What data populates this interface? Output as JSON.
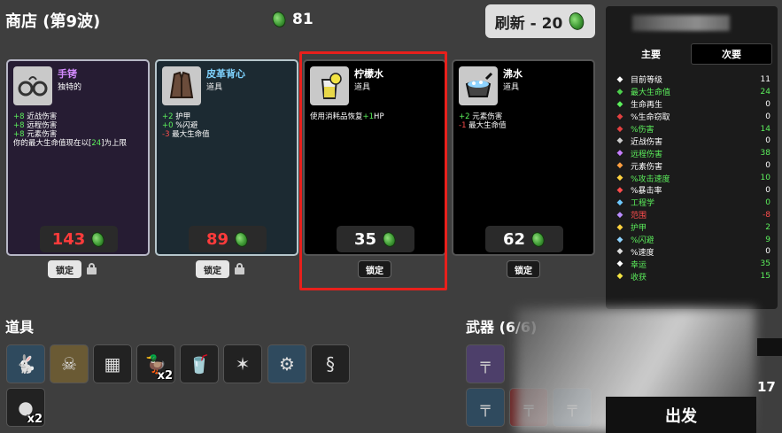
{
  "header": {
    "title": "商店 (第9波)",
    "materials": "81",
    "refresh_label": "刷新 - 20"
  },
  "shop": [
    {
      "name": "手铐",
      "type": "独特的",
      "stats": [
        {
          "prefix": "+8",
          "text": " 近战伤害",
          "tone": "pos"
        },
        {
          "prefix": "+8",
          "text": " 远程伤害",
          "tone": "pos"
        },
        {
          "prefix": "+8",
          "text": " 元素伤害",
          "tone": "pos"
        }
      ],
      "note_a": "你的最大生命值现在以[",
      "note_hl": "24",
      "note_b": "]为上限",
      "price": "143",
      "price_red": true,
      "lock_label": "锁定",
      "icon": "handcuffs-icon"
    },
    {
      "name": "皮革背心",
      "type": "道具",
      "stats": [
        {
          "prefix": "+2",
          "text": " 护甲",
          "tone": "pos"
        },
        {
          "prefix": "+0",
          "text": " %闪避",
          "tone": "pos"
        },
        {
          "prefix": "-3",
          "text": " 最大生命值",
          "tone": "neg"
        }
      ],
      "price": "89",
      "price_red": true,
      "lock_label": "锁定",
      "icon": "leather-vest-icon"
    },
    {
      "name": "柠檬水",
      "type": "道具",
      "desc_a": "使用消耗品恢复",
      "desc_hl": "+1",
      "desc_b": "HP",
      "price": "35",
      "price_red": false,
      "lock_label": "锁定",
      "icon": "lemonade-icon"
    },
    {
      "name": "沸水",
      "type": "道具",
      "stats": [
        {
          "prefix": "+2",
          "text": " 元素伤害",
          "tone": "pos"
        },
        {
          "prefix": "-1",
          "text": " 最大生命值",
          "tone": "neg"
        }
      ],
      "price": "62",
      "price_red": false,
      "lock_label": "锁定",
      "icon": "boiling-water-icon"
    }
  ],
  "stats_panel": {
    "tab_primary": "主要",
    "tab_secondary": "次要",
    "rows": [
      {
        "label": "目前等级",
        "value": "11",
        "color": "white",
        "icon": "level-icon"
      },
      {
        "label": "最大生命值",
        "value": "24",
        "color": "green",
        "icon": "heart-icon"
      },
      {
        "label": "生命再生",
        "value": "0",
        "color": "white",
        "icon": "regen-icon"
      },
      {
        "label": "%生命窃取",
        "value": "0",
        "color": "white",
        "icon": "lifesteal-icon"
      },
      {
        "label": "%伤害",
        "value": "14",
        "color": "green",
        "icon": "damage-icon"
      },
      {
        "label": "近战伤害",
        "value": "0",
        "color": "white",
        "icon": "melee-icon"
      },
      {
        "label": "远程伤害",
        "value": "38",
        "color": "green",
        "icon": "ranged-icon"
      },
      {
        "label": "元素伤害",
        "value": "0",
        "color": "white",
        "icon": "elemental-icon"
      },
      {
        "label": "%攻击速度",
        "value": "10",
        "color": "green",
        "icon": "attack-speed-icon"
      },
      {
        "label": "%暴击率",
        "value": "0",
        "color": "white",
        "icon": "crit-icon"
      },
      {
        "label": "工程学",
        "value": "0",
        "color": "green",
        "icon": "engineering-icon"
      },
      {
        "label": "范围",
        "value": "-8",
        "color": "red",
        "icon": "range-icon"
      },
      {
        "label": "护甲",
        "value": "2",
        "color": "green",
        "icon": "armor-icon"
      },
      {
        "label": "%闪避",
        "value": "9",
        "color": "green",
        "icon": "dodge-icon"
      },
      {
        "label": "%速度",
        "value": "0",
        "color": "white",
        "icon": "speed-icon"
      },
      {
        "label": "幸运",
        "value": "35",
        "color": "green",
        "icon": "luck-icon"
      },
      {
        "label": "收获",
        "value": "15",
        "color": "green",
        "icon": "harvest-icon"
      }
    ]
  },
  "inventory": {
    "items_title": "道具",
    "weapons_title": "武器 (6/6)",
    "items": [
      {
        "icon": "rabbit-icon",
        "qty": ""
      },
      {
        "icon": "mask-icon",
        "qty": ""
      },
      {
        "icon": "vest-icon",
        "qty": ""
      },
      {
        "icon": "duck-icon",
        "qty": "x2"
      },
      {
        "icon": "lemonade-icon",
        "qty": ""
      },
      {
        "icon": "thorn-icon",
        "qty": ""
      },
      {
        "icon": "bone-icon",
        "qty": ""
      },
      {
        "icon": "tentacle-icon",
        "qty": ""
      },
      {
        "icon": "snowball-icon",
        "qty": "x2"
      }
    ],
    "weapons": [
      {
        "icon": "minigun-icon"
      },
      {
        "icon": "shotgun-icon"
      },
      {
        "icon": "rifle-icon"
      },
      {
        "icon": "rifle-icon-2"
      }
    ]
  },
  "footer": {
    "go_label": "出发",
    "side_number": "17"
  }
}
